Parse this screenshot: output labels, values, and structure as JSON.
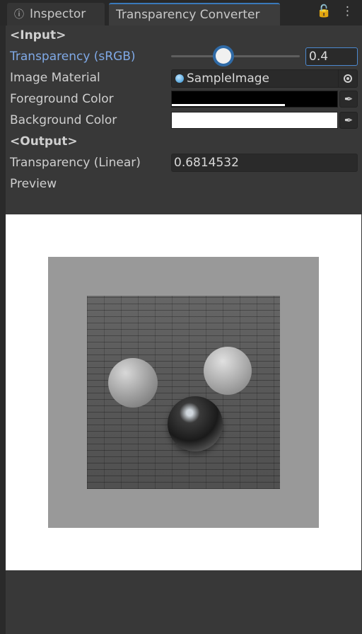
{
  "tabs": {
    "inspector_label": "Inspector",
    "converter_label": "Transparency Converter"
  },
  "input": {
    "header": "<Input>",
    "transparency_label": "Transparency (sRGB)",
    "transparency_value": "0.4",
    "slider_value": 0.4,
    "image_material_label": "Image Material",
    "image_material_value": "SampleImage",
    "foreground_label": "Foreground Color",
    "foreground_color": "#000000",
    "background_label": "Background Color",
    "background_color": "#ffffff"
  },
  "output": {
    "header": "<Output>",
    "transparency_linear_label": "Transparency (Linear)",
    "transparency_linear_value": "0.6814532",
    "preview_label": "Preview"
  },
  "colors": {
    "accent": "#3a79bb",
    "active_label": "#7fa9e6",
    "panel_bg": "#383838"
  },
  "icons": [
    "info-icon",
    "lock-icon",
    "kebab-menu-icon",
    "object-picker-icon",
    "eyedropper-icon"
  ]
}
